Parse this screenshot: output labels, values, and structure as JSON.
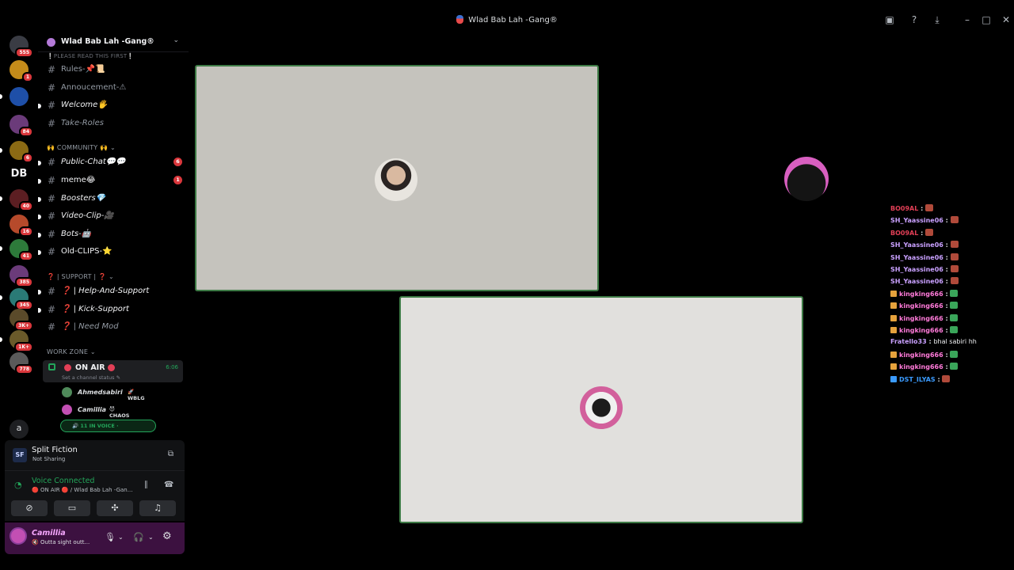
{
  "window": {
    "title": "Wlad Bab Lah -Gang®"
  },
  "rail": {
    "servers": [
      {
        "name": "discord-home",
        "badge": "555",
        "color": "#3a3c44"
      },
      {
        "name": "server-1",
        "badge": "1",
        "color": "#c48b1a"
      },
      {
        "name": "server-2",
        "badge": "",
        "color": "#1e4fa8"
      },
      {
        "name": "server-3",
        "badge": "84",
        "color": "#6b3b7a"
      },
      {
        "name": "server-4",
        "badge": "6",
        "color": "#8b6a14"
      },
      {
        "name": "server-5",
        "badge": "",
        "color": "#f2f3f5"
      },
      {
        "name": "server-6",
        "badge": "40",
        "color": "#5c1e22"
      },
      {
        "name": "server-7",
        "badge": "16",
        "color": "#b64a2b"
      },
      {
        "name": "server-8",
        "badge": "41",
        "color": "#2d7a3a"
      },
      {
        "name": "server-9",
        "badge": "385",
        "color": "#6b3b7a"
      },
      {
        "name": "server-10",
        "badge": "345",
        "color": "#2a7a76"
      },
      {
        "name": "server-11",
        "badge": "3K+",
        "color": "#5a4a2a"
      },
      {
        "name": "server-12",
        "badge": "1K+",
        "color": "#6a5a2a"
      },
      {
        "name": "server-13",
        "badge": "778",
        "color": "#5a5a5a"
      },
      {
        "name": "server-14",
        "badge": "",
        "color": "#1e1f22"
      }
    ],
    "server14_letter": "a",
    "server5_letters": "DB"
  },
  "guild": {
    "name": "Wlad Bab Lah -Gang®"
  },
  "sidebar": {
    "top_category_text": "❕PLEASE READ THIS FIRST❕",
    "channels_top": [
      {
        "name": "Rules-📌📜",
        "italic": false,
        "unread": false,
        "badge": ""
      },
      {
        "name": "Annoucement-⚠",
        "italic": false,
        "unread": false,
        "badge": ""
      },
      {
        "name": "Welcome🖐",
        "italic": true,
        "unread": true,
        "badge": ""
      },
      {
        "name": "Take-Roles",
        "italic": true,
        "unread": false,
        "badge": ""
      }
    ],
    "community_category": "🙌 COMMUNITY 🙌",
    "channels_community": [
      {
        "name": "Public-Chat💬💬",
        "italic": true,
        "unread": true,
        "badge": "6"
      },
      {
        "name": "meme😂",
        "italic": false,
        "unread": true,
        "badge": "1"
      },
      {
        "name": "Boosters💎",
        "italic": true,
        "unread": true,
        "badge": ""
      },
      {
        "name": "Video-Clip-🎥",
        "italic": true,
        "unread": true,
        "badge": ""
      },
      {
        "name": "Bots-🤖",
        "italic": true,
        "unread": true,
        "badge": ""
      },
      {
        "name": "Old-CLIPS-⭐",
        "italic": false,
        "unread": true,
        "badge": ""
      }
    ],
    "support_category": "❓ | SUPPORT | ❓",
    "channels_support": [
      {
        "name": "❓ | Help-And-Support",
        "italic": true,
        "unread": true
      },
      {
        "name": "❓ | Kick-Support",
        "italic": true,
        "unread": true
      },
      {
        "name": "❓ | Need Mod",
        "italic": true,
        "unread": false
      }
    ],
    "work_category": "WORK ZONE",
    "voice_channel": {
      "name": "ON AIR",
      "time": "6:06",
      "status": "Set a channel status ✎"
    },
    "voice_users": [
      {
        "name": "Ahmedsabiri",
        "tag": "🚀 WBLG",
        "color": "#4f8a5a"
      },
      {
        "name": "Camillia",
        "tag": "😈 CHAOS",
        "color": "#c24fb3"
      }
    ],
    "in_voice": "🔊 11 IN VOICE ·"
  },
  "activity": {
    "icon": "SF",
    "title": "Split Fiction",
    "subtitle": "Not Sharing"
  },
  "voice_connected": {
    "title": "Voice Connected",
    "subtitle": "🔴 ON AIR 🔴 / Wlad Bab Lah -Gan..."
  },
  "user": {
    "name": "Camillia",
    "status": "🔇 Outta sight outt..."
  },
  "stage": {
    "chat": [
      {
        "name": "BO09AL",
        "color": "#e23f56",
        "badge": false,
        "text": "",
        "emote": "#b04a3a"
      },
      {
        "name": "SH_Yaassine06",
        "color": "#c9a0ff",
        "badge": false,
        "text": "",
        "emote": "#b04a3a"
      },
      {
        "name": "BO09AL",
        "color": "#e23f56",
        "badge": false,
        "text": "",
        "emote": "#b04a3a"
      },
      {
        "name": "SH_Yaassine06",
        "color": "#c9a0ff",
        "badge": false,
        "text": "",
        "emote": "#b04a3a"
      },
      {
        "name": "SH_Yaassine06",
        "color": "#c9a0ff",
        "badge": false,
        "text": "",
        "emote": "#b04a3a"
      },
      {
        "name": "SH_Yaassine06",
        "color": "#c9a0ff",
        "badge": false,
        "text": "",
        "emote": "#b04a3a"
      },
      {
        "name": "SH_Yaassine06",
        "color": "#c9a0ff",
        "badge": false,
        "text": "",
        "emote": "#b04a3a"
      },
      {
        "name": "kingking666",
        "color": "#ff7ad9",
        "badge": true,
        "text": "",
        "emote": "#3aa65a"
      },
      {
        "name": "kingking666",
        "color": "#ff7ad9",
        "badge": true,
        "text": "",
        "emote": "#3aa65a"
      },
      {
        "name": "kingking666",
        "color": "#ff7ad9",
        "badge": true,
        "text": "",
        "emote": "#3aa65a"
      },
      {
        "name": "kingking666",
        "color": "#ff7ad9",
        "badge": true,
        "text": "",
        "emote": "#3aa65a"
      },
      {
        "name": "Fratello33",
        "color": "#c9a0ff",
        "badge": false,
        "text": "bhal sabiri hh",
        "emote": ""
      },
      {
        "name": "kingking666",
        "color": "#ff7ad9",
        "badge": true,
        "text": "",
        "emote": "#3aa65a"
      },
      {
        "name": "kingking666",
        "color": "#ff7ad9",
        "badge": true,
        "text": "",
        "emote": "#3aa65a"
      },
      {
        "name": "DST_ILYAS",
        "color": "#3b9bff",
        "badge": true,
        "text": "",
        "emote": "#b04a3a"
      }
    ]
  }
}
